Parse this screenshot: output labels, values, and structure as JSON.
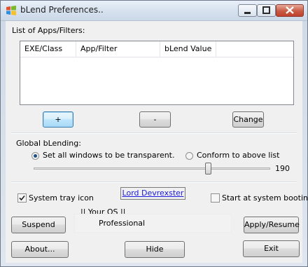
{
  "window": {
    "title": "bLend Preferences.."
  },
  "apps_section": {
    "label": "List of Apps/Filters:",
    "columns": [
      "EXE/Class",
      "App/Filter",
      "bLend Value"
    ],
    "rows": [],
    "add_label": "+",
    "remove_label": "-",
    "change_label": "Change"
  },
  "global_section": {
    "label": "Global bLending:",
    "option_all": "Set all windows to be transparent.",
    "option_conform": "Conform to above list",
    "selected_option": "all",
    "transparency_value": "190",
    "transparency_fraction": 0.745
  },
  "tray": {
    "label": "System tray icon",
    "checked": true
  },
  "author_link": "Lord Devrexster",
  "startup": {
    "label": "Start at system booting.",
    "checked": false
  },
  "os": {
    "heading": "|| Your OS ||",
    "value": "Professional"
  },
  "buttons": {
    "suspend": "Suspend",
    "apply": "Apply/Resume",
    "about": "About...",
    "hide": "Hide",
    "exit": "Exit"
  },
  "icons": {
    "app": "windows-logo-icon",
    "minimize": "minimize-icon",
    "maximize": "maximize-icon",
    "close": "close-icon"
  }
}
